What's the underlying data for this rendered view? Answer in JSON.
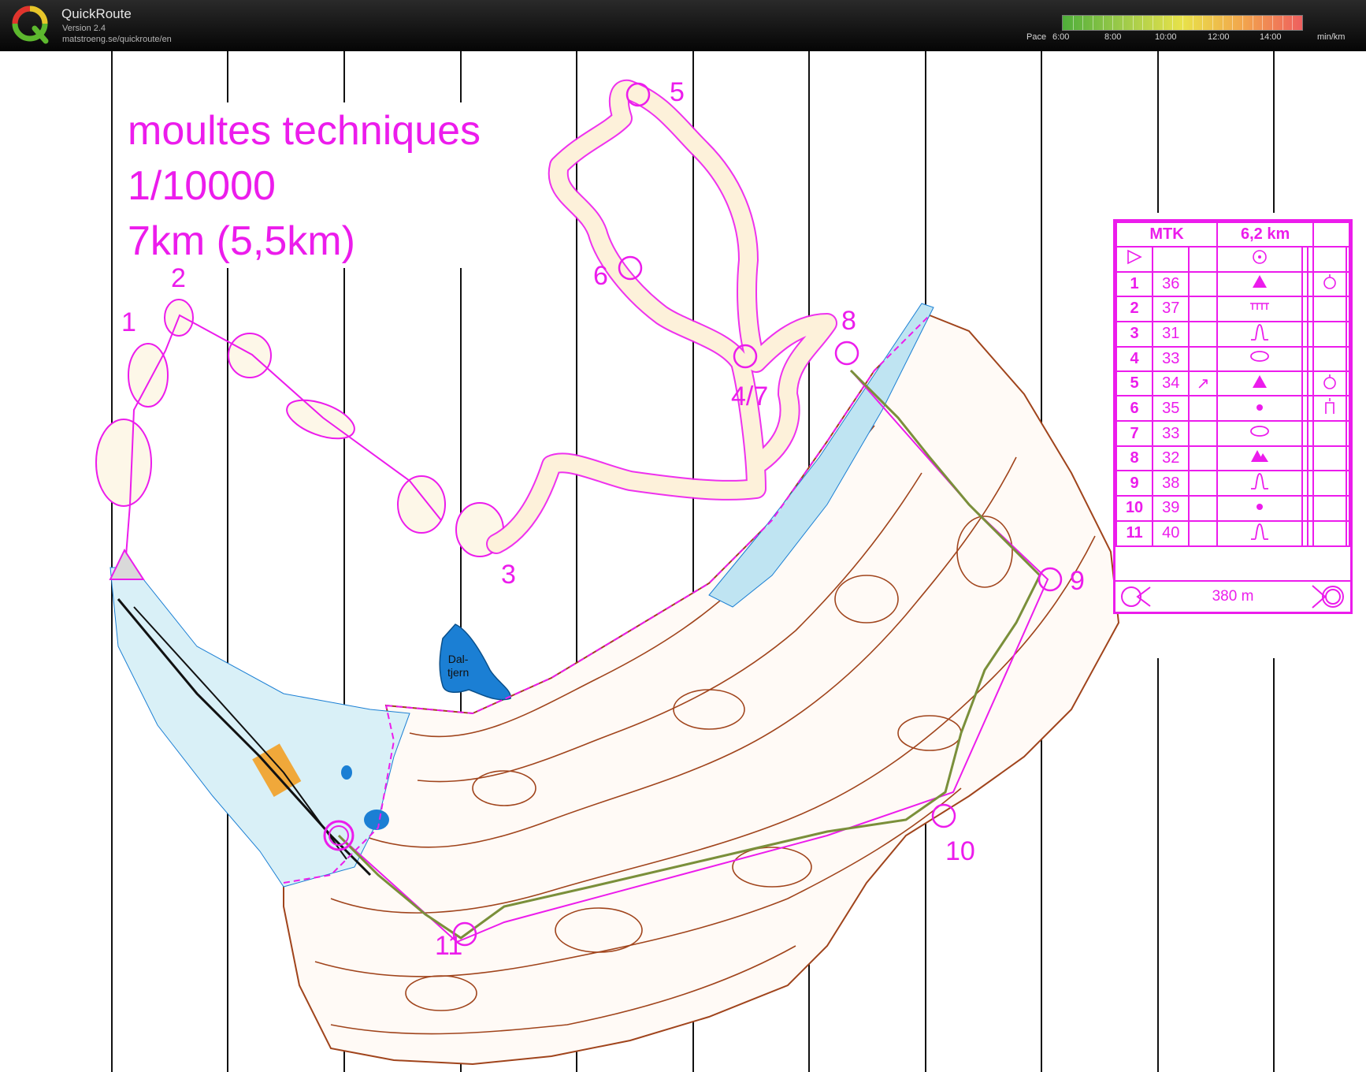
{
  "app": {
    "name": "QuickRoute",
    "version": "Version 2.4",
    "url": "matstroeng.se/quickroute/en"
  },
  "pace_legend": {
    "label": "Pace",
    "ticks": [
      "6:00",
      "8:00",
      "10:00",
      "12:00",
      "14:00"
    ],
    "unit": "min/km"
  },
  "map_title": {
    "line1": "moultes techniques",
    "line2": "1/10000",
    "line3": "7km (5,5km)"
  },
  "controls": {
    "c1": "1",
    "c2": "2",
    "c3": "3",
    "c47": "4/7",
    "c5": "5",
    "c6": "6",
    "c8": "8",
    "c9": "9",
    "c10": "10",
    "c11": "11"
  },
  "lake_label": {
    "line1": "Dal-",
    "line2": "tjern"
  },
  "control_description": {
    "event": "MTK",
    "length": "6,2 km",
    "rows": [
      {
        "num": "1",
        "code": "36",
        "dir": "",
        "symbol": "knoll-triangle",
        "extra": "boulder"
      },
      {
        "num": "2",
        "code": "37",
        "dir": "",
        "symbol": "fence",
        "extra": ""
      },
      {
        "num": "3",
        "code": "31",
        "dir": "",
        "symbol": "spur",
        "extra": ""
      },
      {
        "num": "4",
        "code": "33",
        "dir": "",
        "symbol": "depression",
        "extra": ""
      },
      {
        "num": "5",
        "code": "34",
        "dir": "↗",
        "symbol": "knoll-triangle",
        "extra": "boulder"
      },
      {
        "num": "6",
        "code": "35",
        "dir": "",
        "symbol": "dot",
        "extra": "foot"
      },
      {
        "num": "7",
        "code": "33",
        "dir": "",
        "symbol": "depression",
        "extra": ""
      },
      {
        "num": "8",
        "code": "32",
        "dir": "",
        "symbol": "boulders",
        "extra": ""
      },
      {
        "num": "9",
        "code": "38",
        "dir": "",
        "symbol": "spur",
        "extra": ""
      },
      {
        "num": "10",
        "code": "39",
        "dir": "",
        "symbol": "dot",
        "extra": ""
      },
      {
        "num": "11",
        "code": "40",
        "dir": "",
        "symbol": "spur",
        "extra": ""
      }
    ],
    "finish_distance": "380 m"
  },
  "colors": {
    "course": "#ec1cec",
    "contour": "#a0441c",
    "water": "#1b7fd4",
    "route": "#7a8f3a"
  }
}
